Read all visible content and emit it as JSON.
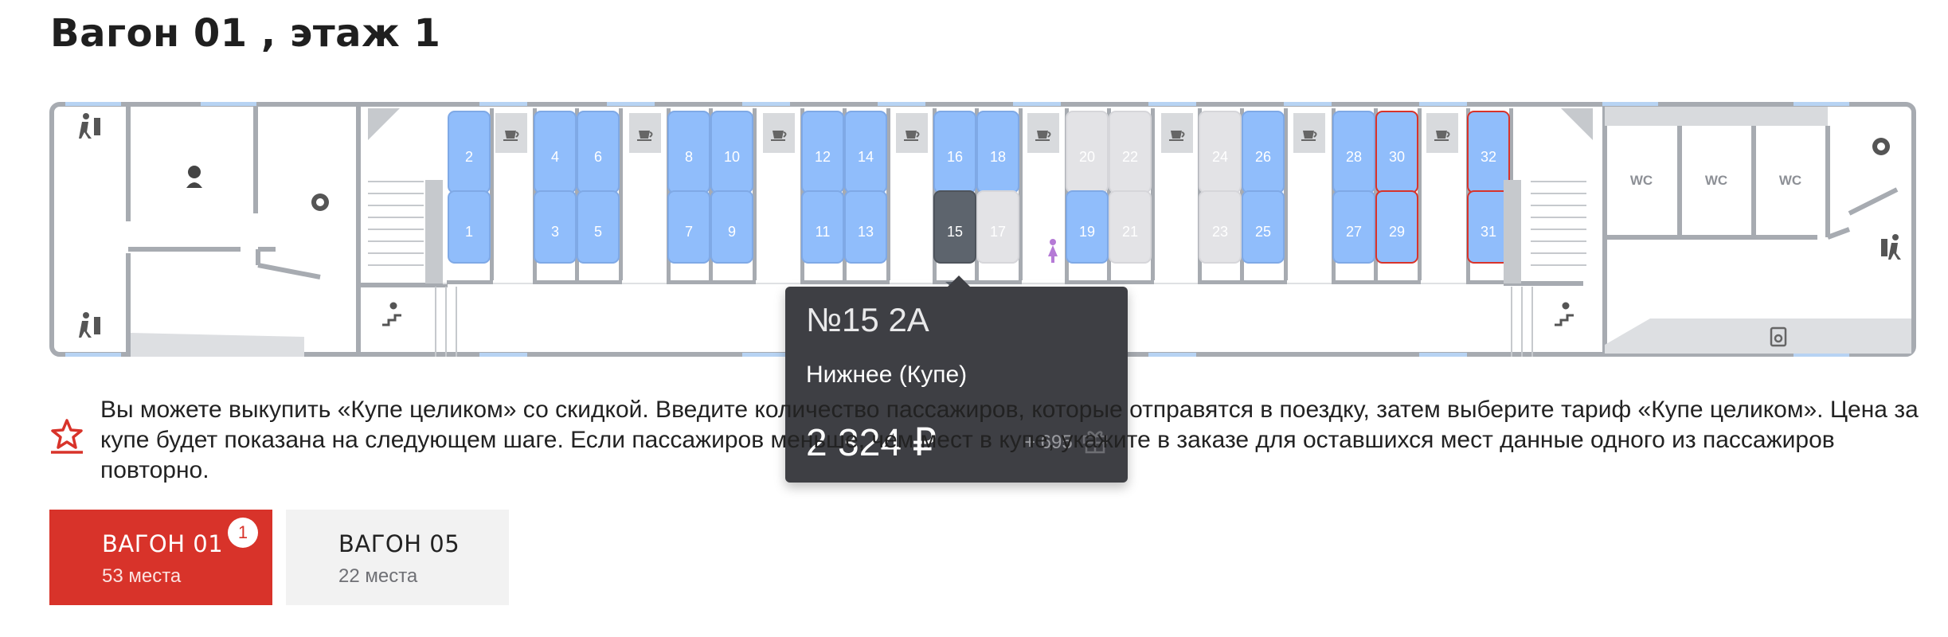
{
  "header": {
    "title": "Вагон 01 , этаж 1"
  },
  "car_map": {
    "wc_label": "WC",
    "seats": [
      {
        "n": "2",
        "col": 0,
        "row": "top",
        "status": "free"
      },
      {
        "n": "1",
        "col": 0,
        "row": "bottom",
        "status": "free"
      },
      {
        "n": "4",
        "col": 1,
        "row": "top",
        "status": "free"
      },
      {
        "n": "3",
        "col": 1,
        "row": "bottom",
        "status": "free"
      },
      {
        "n": "6",
        "col": 2,
        "row": "top",
        "status": "free"
      },
      {
        "n": "5",
        "col": 2,
        "row": "bottom",
        "status": "free"
      },
      {
        "n": "8",
        "col": 3,
        "row": "top",
        "status": "free"
      },
      {
        "n": "7",
        "col": 3,
        "row": "bottom",
        "status": "free"
      },
      {
        "n": "10",
        "col": 4,
        "row": "top",
        "status": "free"
      },
      {
        "n": "9",
        "col": 4,
        "row": "bottom",
        "status": "free"
      },
      {
        "n": "12",
        "col": 5,
        "row": "top",
        "status": "free"
      },
      {
        "n": "11",
        "col": 5,
        "row": "bottom",
        "status": "free"
      },
      {
        "n": "14",
        "col": 6,
        "row": "top",
        "status": "free"
      },
      {
        "n": "13",
        "col": 6,
        "row": "bottom",
        "status": "free"
      },
      {
        "n": "16",
        "col": 7,
        "row": "top",
        "status": "free"
      },
      {
        "n": "15",
        "col": 7,
        "row": "bottom",
        "status": "selected"
      },
      {
        "n": "18",
        "col": 8,
        "row": "top",
        "status": "free"
      },
      {
        "n": "17",
        "col": 8,
        "row": "bottom",
        "status": "taken"
      },
      {
        "n": "20",
        "col": 9,
        "row": "top",
        "status": "taken"
      },
      {
        "n": "19",
        "col": 9,
        "row": "bottom",
        "status": "free"
      },
      {
        "n": "22",
        "col": 10,
        "row": "top",
        "status": "taken"
      },
      {
        "n": "21",
        "col": 10,
        "row": "bottom",
        "status": "taken"
      },
      {
        "n": "24",
        "col": 11,
        "row": "top",
        "status": "taken"
      },
      {
        "n": "23",
        "col": 11,
        "row": "bottom",
        "status": "taken"
      },
      {
        "n": "26",
        "col": 12,
        "row": "top",
        "status": "free"
      },
      {
        "n": "25",
        "col": 12,
        "row": "bottom",
        "status": "free"
      },
      {
        "n": "28",
        "col": 13,
        "row": "top",
        "status": "free"
      },
      {
        "n": "27",
        "col": 13,
        "row": "bottom",
        "status": "free"
      },
      {
        "n": "30",
        "col": 14,
        "row": "top",
        "status": "special"
      },
      {
        "n": "29",
        "col": 14,
        "row": "bottom",
        "status": "special"
      },
      {
        "n": "32",
        "col": 15,
        "row": "top",
        "status": "special"
      },
      {
        "n": "31",
        "col": 15,
        "row": "bottom",
        "status": "special"
      }
    ],
    "colors": {
      "free": "#90bdfb",
      "taken": "#e3e3e6",
      "selected": "#5d646d",
      "special_border": "#d8332a",
      "wall": "#a7abb1",
      "window": "#b7d3f3"
    },
    "icons": [
      "exit-icon",
      "conductor-icon",
      "gear-icon",
      "cup-icon",
      "woman-icon",
      "stairs-icon",
      "trash-icon"
    ]
  },
  "tooltip": {
    "seat_number": "№15 2А",
    "seat_type": "Нижнее (Купе)",
    "price": "2 324 ₽",
    "bonus": "+ 695"
  },
  "info": {
    "text": "Вы можете выкупить «Купе целиком» со скидкой. Введите количество пассажиров, которые отправятся в поездку, затем выберите тариф «Купе целиком». Цена за купе будет показана на следующем шаге. Если пассажиров меньше, чем мест в купе, укажите в заказе для оставшихся мест данные одного из пассажиров повторно."
  },
  "tabs": [
    {
      "title": "ВАГОН 01",
      "subtitle": "53 места",
      "badge": "1",
      "active": true
    },
    {
      "title": "ВАГОН 05",
      "subtitle": "22 места",
      "active": false
    }
  ]
}
